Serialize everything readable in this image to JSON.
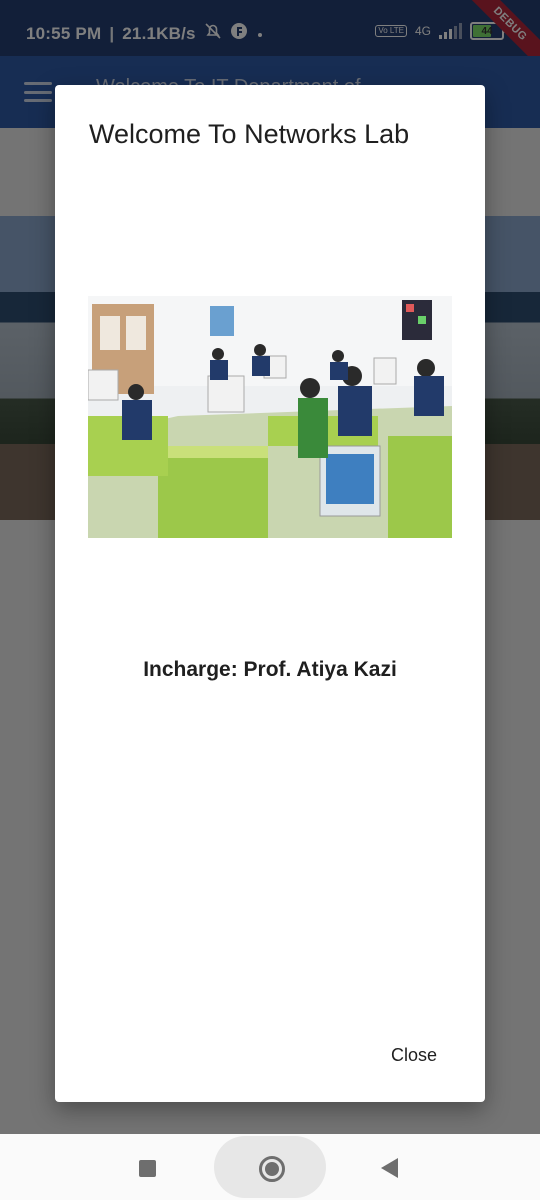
{
  "status_bar": {
    "time": "10:55 PM",
    "separator": "|",
    "speed": "21.1KB/s",
    "network_type": "4G",
    "volte_label": "Vo LTE",
    "battery_level": "44",
    "debug_label": "DEBUG"
  },
  "app_bar": {
    "title": "Welcome To IT Department of..."
  },
  "dialog": {
    "title": "Welcome To Networks Lab",
    "incharge": "Incharge: Prof. Atiya Kazi",
    "close_label": "Close"
  },
  "colors": {
    "status_bar_bg": "#253e73",
    "app_bar_bg": "#2f5aa6",
    "debug_banner": "#b3263b"
  },
  "icons": {
    "menu": "hamburger-icon",
    "nav_recent": "square-icon",
    "nav_home": "circle-icon",
    "nav_back": "triangle-back-icon"
  }
}
